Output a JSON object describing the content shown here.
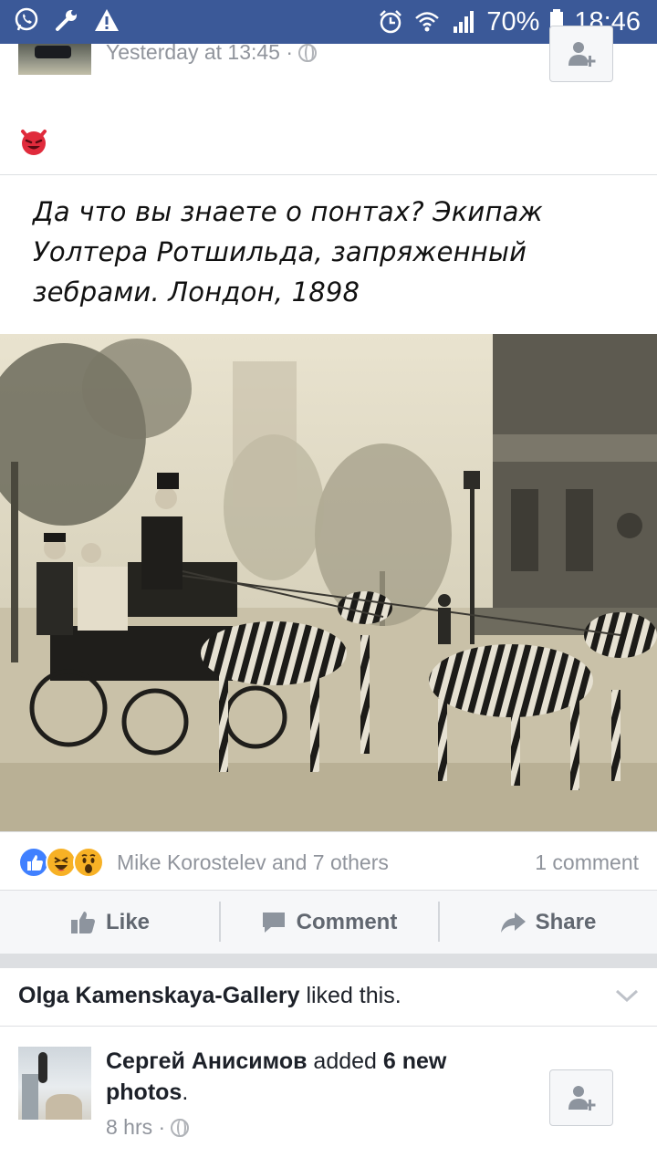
{
  "status_bar": {
    "battery": "70%",
    "time": "18:46",
    "icons": [
      "whatsapp-icon",
      "wrench-icon",
      "warning-icon",
      "alarm-icon",
      "wifi-icon",
      "signal-icon",
      "battery-icon"
    ]
  },
  "previous_post": {
    "timestamp": "Yesterday at 13:45 ·",
    "privacy_icon": "globe-icon",
    "emoji_icon": "devil-emoji-icon"
  },
  "post": {
    "image_caption": [
      "Да что вы знаете о понтах? Экипаж",
      "Уолтера Ротшильда, запряженный",
      "зебрами. Лондон, 1898"
    ],
    "reactions": {
      "icons": [
        "like-reaction-icon",
        "haha-reaction-icon",
        "wow-reaction-icon"
      ],
      "names": "Mike Korostelev and 7 others",
      "comments": "1 comment"
    },
    "actions": {
      "like": "Like",
      "comment": "Comment",
      "share": "Share"
    }
  },
  "liked_story": {
    "actor": "Olga Kamenskaya-Gallery",
    "text": " liked this."
  },
  "next_story": {
    "actor": "Сергей Анисимов",
    "mid": " added ",
    "object": "6 new photos",
    "end": ".",
    "timestamp": "8 hrs ·"
  },
  "colors": {
    "brand": "#3b5998",
    "meta_text": "#90949c",
    "action_text": "#616770"
  }
}
